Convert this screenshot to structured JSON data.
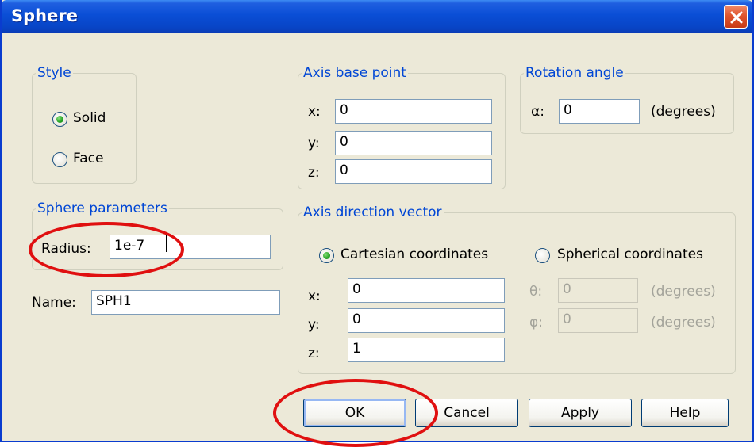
{
  "window": {
    "title": "Sphere"
  },
  "style": {
    "legend": "Style",
    "options": [
      {
        "label": "Solid",
        "selected": true
      },
      {
        "label": "Face",
        "selected": false
      }
    ]
  },
  "axis_base_point": {
    "legend": "Axis base point",
    "x_label": "x:",
    "x_value": "0",
    "y_label": "y:",
    "y_value": "0",
    "z_label": "z:",
    "z_value": "0"
  },
  "rotation_angle": {
    "legend": "Rotation angle",
    "alpha_label": "α:",
    "alpha_value": "0",
    "unit": "(degrees)"
  },
  "sphere_parameters": {
    "legend": "Sphere parameters",
    "radius_label": "Radius:",
    "radius_value": "1e-7"
  },
  "name": {
    "label": "Name:",
    "value": "SPH1"
  },
  "axis_direction_vector": {
    "legend": "Axis direction vector",
    "cartesian_label": "Cartesian coordinates",
    "cartesian_selected": true,
    "spherical_label": "Spherical coordinates",
    "spherical_selected": false,
    "x_label": "x:",
    "x_value": "0",
    "y_label": "y:",
    "y_value": "0",
    "z_label": "z:",
    "z_value": "1",
    "theta_label": "θ:",
    "theta_value": "0",
    "theta_unit": "(degrees)",
    "phi_label": "φ:",
    "phi_value": "0",
    "phi_unit": "(degrees)"
  },
  "buttons": {
    "ok": "OK",
    "cancel": "Cancel",
    "apply": "Apply",
    "help": "Help"
  },
  "colors": {
    "annotation_ring": "#e01010",
    "group_legend": "#0046d5",
    "titlebar": "#0a4ed6"
  },
  "icons": {
    "close": "close-icon",
    "radio": "radio-icon"
  }
}
